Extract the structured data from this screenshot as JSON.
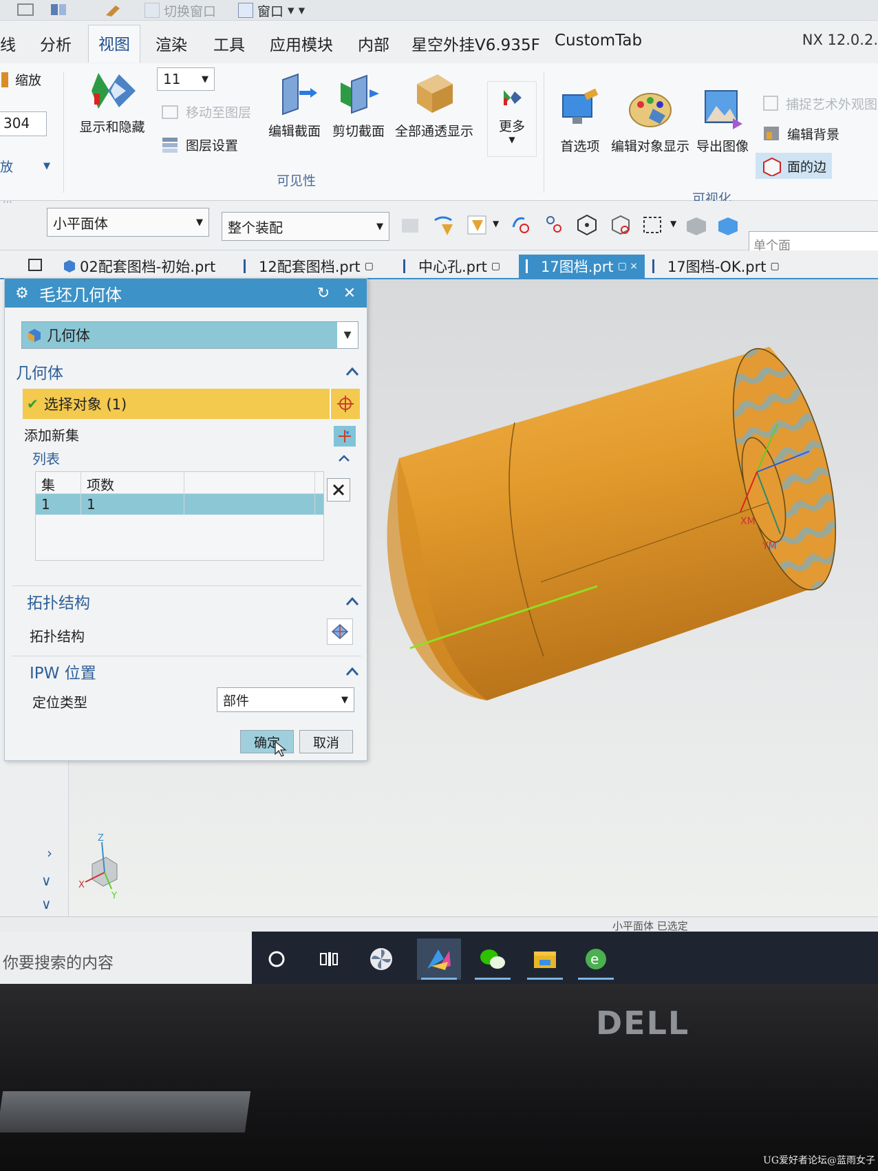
{
  "quick_access": {
    "switch_window": "切换窗口",
    "window": "窗口"
  },
  "ribbon_tabs": [
    "线",
    "分析",
    "视图",
    "渲染",
    "工具",
    "应用模块",
    "内部",
    "星空外挂V6.935F",
    "CustomTab"
  ],
  "version": "NX 12.0.2.",
  "ribbon": {
    "zoom": "缩放",
    "left_value": "304",
    "left_dd": "放",
    "show_hide": "显示和隐藏",
    "layer_value": "11",
    "move_to_layer": "移动至图层",
    "layer_settings": "图层设置",
    "edit_section": "编辑截面",
    "clip_section": "剪切截面",
    "all_transparent": "全部通透显示",
    "more": "更多",
    "visibility_group": "可见性",
    "preferences": "首选项",
    "edit_object_display": "编辑对象显示",
    "export_image": "导出图像",
    "capture_art": "捕捉艺术外观图",
    "edit_background": "编辑背景",
    "face_edges": "面的边",
    "visualization_group": "可视化"
  },
  "selection_bar": {
    "filter": "小平面体",
    "scope": "整个装配",
    "single_face": "单个面"
  },
  "file_tabs": [
    {
      "name": "02配套图档-初始.prt",
      "active": false
    },
    {
      "name": "12配套图档.prt",
      "active": false
    },
    {
      "name": "中心孔.prt",
      "active": false
    },
    {
      "name": "17图档.prt",
      "active": true
    },
    {
      "name": "17图档-OK.prt",
      "active": false
    }
  ],
  "dialog": {
    "title": "毛坯几何体",
    "type_value": "几何体",
    "section_geometry": "几何体",
    "select_object": "选择对象 (1)",
    "add_new_set": "添加新集",
    "list_title": "列表",
    "list_headers": [
      "集",
      "项数"
    ],
    "list_rows": [
      [
        "1",
        "1"
      ]
    ],
    "section_topology": "拓扑结构",
    "topology_label": "拓扑结构",
    "section_ipw": "IPW 位置",
    "locate_type_label": "定位类型",
    "locate_type_value": "部件",
    "ok": "确定",
    "cancel": "取消"
  },
  "viewport": {
    "axis_xm": "XM",
    "axis_ym": "YM",
    "triad_z": "Z",
    "triad_x": "X",
    "triad_y": "Y"
  },
  "status_text": "小平面体 已选定",
  "taskbar": {
    "search": "你要搜索的内容"
  },
  "brand": "DELL",
  "watermark": "UG爱好者论坛@蓝雨女子",
  "colors": {
    "accent": "#3d92c7",
    "part": "#e4a033",
    "highlight": "#f3c94e",
    "selection_row": "#8cc7d6",
    "edge": "#8fe020"
  }
}
